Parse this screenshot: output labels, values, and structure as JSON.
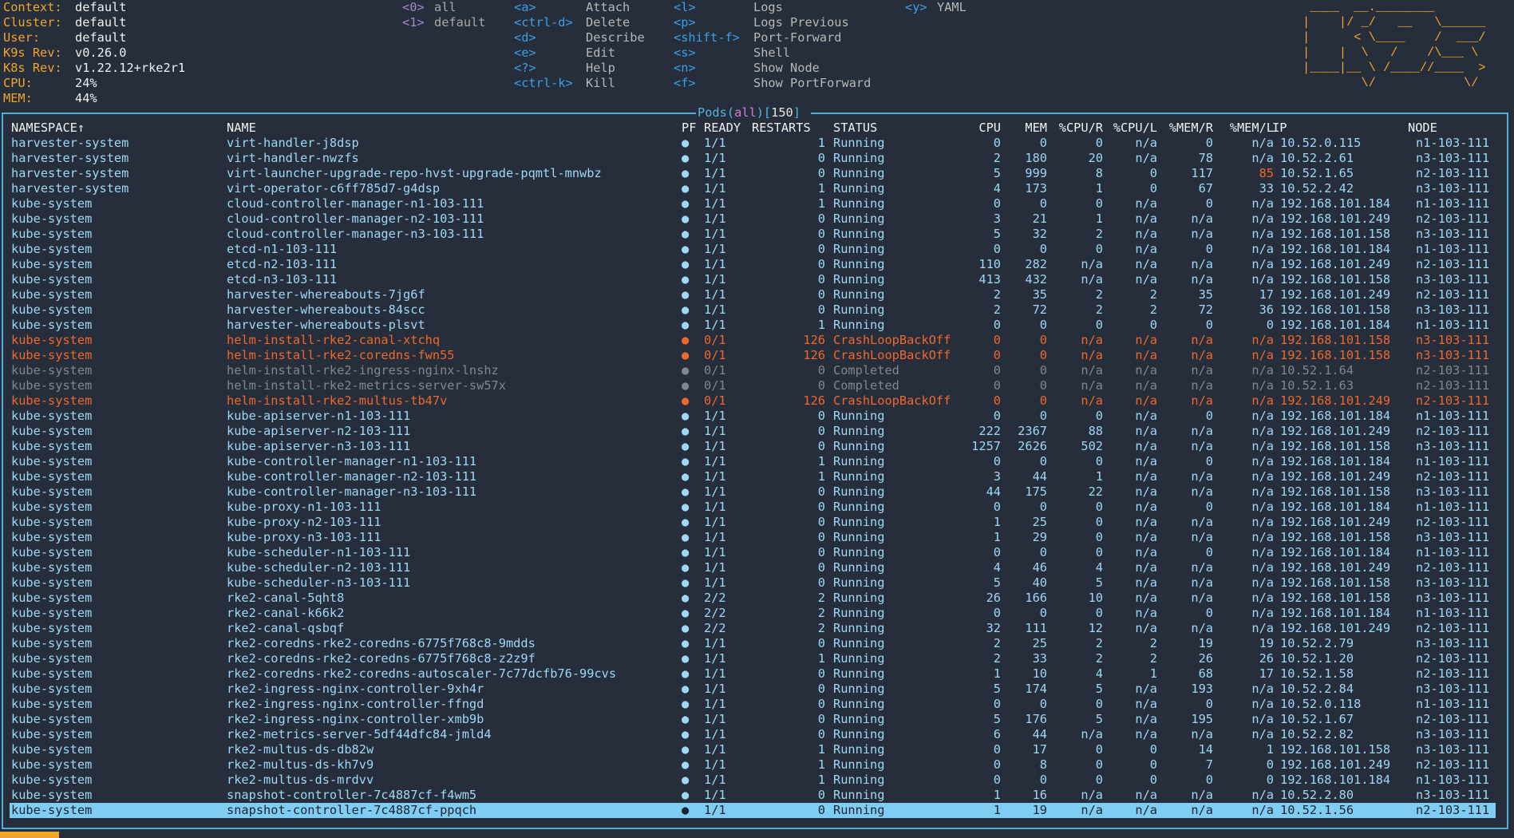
{
  "header": {
    "info": [
      {
        "key": "Context:",
        "value": "default"
      },
      {
        "key": "Cluster:",
        "value": "default"
      },
      {
        "key": "User:",
        "value": "default"
      },
      {
        "key": "K9s Rev:",
        "value": "v0.26.0"
      },
      {
        "key": "K8s Rev:",
        "value": "v1.22.12+rke2r1"
      },
      {
        "key": "CPU:",
        "value": "24%"
      },
      {
        "key": "MEM:",
        "value": "44%"
      }
    ],
    "namespaces": [
      {
        "key": "<0>",
        "label": "all"
      },
      {
        "key": "<1>",
        "label": "default"
      }
    ],
    "shortcuts_col1": [
      {
        "key": "<a>",
        "label": "Attach"
      },
      {
        "key": "<ctrl-d>",
        "label": "Delete"
      },
      {
        "key": "<d>",
        "label": "Describe"
      },
      {
        "key": "<e>",
        "label": "Edit"
      },
      {
        "key": "<?>",
        "label": "Help"
      },
      {
        "key": "<ctrl-k>",
        "label": "Kill"
      }
    ],
    "shortcuts_col2": [
      {
        "key": "<l>",
        "label": "Logs"
      },
      {
        "key": "<p>",
        "label": "Logs Previous"
      },
      {
        "key": "<shift-f>",
        "label": "Port-Forward"
      },
      {
        "key": "<s>",
        "label": "Shell"
      },
      {
        "key": "<n>",
        "label": "Show Node"
      },
      {
        "key": "<f>",
        "label": "Show PortForward"
      }
    ],
    "shortcuts_col3": [
      {
        "key": "<y>",
        "label": "YAML"
      }
    ],
    "logo": " ____  __.________       \n|    |/ _/   __   \\______\n|      < \\____    /  ___/\n|    |  \\   /    /\\___ \\ \n|____|__ \\ /____//____  >\n        \\/            \\/ "
  },
  "table": {
    "title_name": "Pods",
    "title_ns": "all",
    "title_count": "150",
    "columns": {
      "namespace": "NAMESPACE↑",
      "name": "NAME",
      "pf": "PF",
      "ready": "READY",
      "restarts": "RESTARTS",
      "status": "STATUS",
      "cpu": "CPU",
      "mem": "MEM",
      "cpur": "%CPU/R",
      "cpul": "%CPU/L",
      "memr": "%MEM/R",
      "meml": "%MEM/L",
      "ip": "IP",
      "node": "NODE"
    },
    "rows": [
      [
        "harvester-system",
        "virt-handler-j8dsp",
        "●",
        "1/1",
        "1",
        "Running",
        "0",
        "0",
        "0",
        "n/a",
        "0",
        "n/a",
        "10.52.0.115",
        "n1-103-111",
        "ok"
      ],
      [
        "harvester-system",
        "virt-handler-nwzfs",
        "●",
        "1/1",
        "0",
        "Running",
        "2",
        "180",
        "20",
        "n/a",
        "78",
        "n/a",
        "10.52.2.61",
        "n3-103-111",
        "ok"
      ],
      [
        "harvester-system",
        "virt-launcher-upgrade-repo-hvst-upgrade-pqmtl-mnwbz",
        "●",
        "1/1",
        "0",
        "Running",
        "5",
        "999",
        "8",
        "0",
        "117",
        "85",
        "10.52.1.65",
        "n2-103-111",
        "warnml"
      ],
      [
        "harvester-system",
        "virt-operator-c6ff785d7-g4dsp",
        "●",
        "1/1",
        "1",
        "Running",
        "4",
        "173",
        "1",
        "0",
        "67",
        "33",
        "10.52.2.42",
        "n3-103-111",
        "ok"
      ],
      [
        "kube-system",
        "cloud-controller-manager-n1-103-111",
        "●",
        "1/1",
        "1",
        "Running",
        "0",
        "0",
        "0",
        "n/a",
        "0",
        "n/a",
        "192.168.101.184",
        "n1-103-111",
        "ok"
      ],
      [
        "kube-system",
        "cloud-controller-manager-n2-103-111",
        "●",
        "1/1",
        "0",
        "Running",
        "3",
        "21",
        "1",
        "n/a",
        "n/a",
        "n/a",
        "192.168.101.249",
        "n2-103-111",
        "ok"
      ],
      [
        "kube-system",
        "cloud-controller-manager-n3-103-111",
        "●",
        "1/1",
        "0",
        "Running",
        "5",
        "32",
        "2",
        "n/a",
        "n/a",
        "n/a",
        "192.168.101.158",
        "n3-103-111",
        "ok"
      ],
      [
        "kube-system",
        "etcd-n1-103-111",
        "●",
        "1/1",
        "0",
        "Running",
        "0",
        "0",
        "0",
        "n/a",
        "0",
        "n/a",
        "192.168.101.184",
        "n1-103-111",
        "ok"
      ],
      [
        "kube-system",
        "etcd-n2-103-111",
        "●",
        "1/1",
        "0",
        "Running",
        "110",
        "282",
        "n/a",
        "n/a",
        "n/a",
        "n/a",
        "192.168.101.249",
        "n2-103-111",
        "ok"
      ],
      [
        "kube-system",
        "etcd-n3-103-111",
        "●",
        "1/1",
        "0",
        "Running",
        "413",
        "432",
        "n/a",
        "n/a",
        "n/a",
        "n/a",
        "192.168.101.158",
        "n3-103-111",
        "ok"
      ],
      [
        "kube-system",
        "harvester-whereabouts-7jg6f",
        "●",
        "1/1",
        "0",
        "Running",
        "2",
        "35",
        "2",
        "2",
        "35",
        "17",
        "192.168.101.249",
        "n2-103-111",
        "ok"
      ],
      [
        "kube-system",
        "harvester-whereabouts-84scc",
        "●",
        "1/1",
        "0",
        "Running",
        "2",
        "72",
        "2",
        "2",
        "72",
        "36",
        "192.168.101.158",
        "n3-103-111",
        "ok"
      ],
      [
        "kube-system",
        "harvester-whereabouts-plsvt",
        "●",
        "1/1",
        "1",
        "Running",
        "0",
        "0",
        "0",
        "0",
        "0",
        "0",
        "192.168.101.184",
        "n1-103-111",
        "ok"
      ],
      [
        "kube-system",
        "helm-install-rke2-canal-xtchq",
        "●",
        "0/1",
        "126",
        "CrashLoopBackOff",
        "0",
        "0",
        "n/a",
        "n/a",
        "n/a",
        "n/a",
        "192.168.101.158",
        "n3-103-111",
        "err"
      ],
      [
        "kube-system",
        "helm-install-rke2-coredns-fwn55",
        "●",
        "0/1",
        "126",
        "CrashLoopBackOff",
        "0",
        "0",
        "n/a",
        "n/a",
        "n/a",
        "n/a",
        "192.168.101.158",
        "n3-103-111",
        "err"
      ],
      [
        "kube-system",
        "helm-install-rke2-ingress-nginx-lnshz",
        "●",
        "0/1",
        "0",
        "Completed",
        "0",
        "0",
        "n/a",
        "n/a",
        "n/a",
        "n/a",
        "10.52.1.64",
        "n2-103-111",
        "done"
      ],
      [
        "kube-system",
        "helm-install-rke2-metrics-server-sw57x",
        "●",
        "0/1",
        "0",
        "Completed",
        "0",
        "0",
        "n/a",
        "n/a",
        "n/a",
        "n/a",
        "10.52.1.63",
        "n2-103-111",
        "done"
      ],
      [
        "kube-system",
        "helm-install-rke2-multus-tb47v",
        "●",
        "0/1",
        "126",
        "CrashLoopBackOff",
        "0",
        "0",
        "n/a",
        "n/a",
        "n/a",
        "n/a",
        "192.168.101.249",
        "n2-103-111",
        "err"
      ],
      [
        "kube-system",
        "kube-apiserver-n1-103-111",
        "●",
        "1/1",
        "0",
        "Running",
        "0",
        "0",
        "0",
        "n/a",
        "0",
        "n/a",
        "192.168.101.184",
        "n1-103-111",
        "ok"
      ],
      [
        "kube-system",
        "kube-apiserver-n2-103-111",
        "●",
        "1/1",
        "0",
        "Running",
        "222",
        "2367",
        "88",
        "n/a",
        "n/a",
        "n/a",
        "192.168.101.249",
        "n2-103-111",
        "ok"
      ],
      [
        "kube-system",
        "kube-apiserver-n3-103-111",
        "●",
        "1/1",
        "0",
        "Running",
        "1257",
        "2626",
        "502",
        "n/a",
        "n/a",
        "n/a",
        "192.168.101.158",
        "n3-103-111",
        "ok"
      ],
      [
        "kube-system",
        "kube-controller-manager-n1-103-111",
        "●",
        "1/1",
        "1",
        "Running",
        "0",
        "0",
        "0",
        "n/a",
        "0",
        "n/a",
        "192.168.101.184",
        "n1-103-111",
        "ok"
      ],
      [
        "kube-system",
        "kube-controller-manager-n2-103-111",
        "●",
        "1/1",
        "1",
        "Running",
        "3",
        "44",
        "1",
        "n/a",
        "n/a",
        "n/a",
        "192.168.101.249",
        "n2-103-111",
        "ok"
      ],
      [
        "kube-system",
        "kube-controller-manager-n3-103-111",
        "●",
        "1/1",
        "0",
        "Running",
        "44",
        "175",
        "22",
        "n/a",
        "n/a",
        "n/a",
        "192.168.101.158",
        "n3-103-111",
        "ok"
      ],
      [
        "kube-system",
        "kube-proxy-n1-103-111",
        "●",
        "1/1",
        "0",
        "Running",
        "0",
        "0",
        "0",
        "n/a",
        "0",
        "n/a",
        "192.168.101.184",
        "n1-103-111",
        "ok"
      ],
      [
        "kube-system",
        "kube-proxy-n2-103-111",
        "●",
        "1/1",
        "0",
        "Running",
        "1",
        "25",
        "0",
        "n/a",
        "n/a",
        "n/a",
        "192.168.101.249",
        "n2-103-111",
        "ok"
      ],
      [
        "kube-system",
        "kube-proxy-n3-103-111",
        "●",
        "1/1",
        "0",
        "Running",
        "1",
        "29",
        "0",
        "n/a",
        "n/a",
        "n/a",
        "192.168.101.158",
        "n3-103-111",
        "ok"
      ],
      [
        "kube-system",
        "kube-scheduler-n1-103-111",
        "●",
        "1/1",
        "0",
        "Running",
        "0",
        "0",
        "0",
        "n/a",
        "0",
        "n/a",
        "192.168.101.184",
        "n1-103-111",
        "ok"
      ],
      [
        "kube-system",
        "kube-scheduler-n2-103-111",
        "●",
        "1/1",
        "0",
        "Running",
        "4",
        "46",
        "4",
        "n/a",
        "n/a",
        "n/a",
        "192.168.101.249",
        "n2-103-111",
        "ok"
      ],
      [
        "kube-system",
        "kube-scheduler-n3-103-111",
        "●",
        "1/1",
        "0",
        "Running",
        "5",
        "40",
        "5",
        "n/a",
        "n/a",
        "n/a",
        "192.168.101.158",
        "n3-103-111",
        "ok"
      ],
      [
        "kube-system",
        "rke2-canal-5qht8",
        "●",
        "2/2",
        "2",
        "Running",
        "26",
        "166",
        "10",
        "n/a",
        "n/a",
        "n/a",
        "192.168.101.158",
        "n3-103-111",
        "ok"
      ],
      [
        "kube-system",
        "rke2-canal-k66k2",
        "●",
        "2/2",
        "2",
        "Running",
        "0",
        "0",
        "0",
        "n/a",
        "0",
        "n/a",
        "192.168.101.184",
        "n1-103-111",
        "ok"
      ],
      [
        "kube-system",
        "rke2-canal-qsbqf",
        "●",
        "2/2",
        "2",
        "Running",
        "32",
        "111",
        "12",
        "n/a",
        "n/a",
        "n/a",
        "192.168.101.249",
        "n2-103-111",
        "ok"
      ],
      [
        "kube-system",
        "rke2-coredns-rke2-coredns-6775f768c8-9mdds",
        "●",
        "1/1",
        "0",
        "Running",
        "2",
        "25",
        "2",
        "2",
        "19",
        "19",
        "10.52.2.79",
        "n3-103-111",
        "ok"
      ],
      [
        "kube-system",
        "rke2-coredns-rke2-coredns-6775f768c8-z2z9f",
        "●",
        "1/1",
        "1",
        "Running",
        "2",
        "33",
        "2",
        "2",
        "26",
        "26",
        "10.52.1.20",
        "n2-103-111",
        "ok"
      ],
      [
        "kube-system",
        "rke2-coredns-rke2-coredns-autoscaler-7c77dcfb76-99cvs",
        "●",
        "1/1",
        "0",
        "Running",
        "1",
        "10",
        "4",
        "1",
        "68",
        "17",
        "10.52.1.58",
        "n2-103-111",
        "ok"
      ],
      [
        "kube-system",
        "rke2-ingress-nginx-controller-9xh4r",
        "●",
        "1/1",
        "0",
        "Running",
        "5",
        "174",
        "5",
        "n/a",
        "193",
        "n/a",
        "10.52.2.84",
        "n3-103-111",
        "ok"
      ],
      [
        "kube-system",
        "rke2-ingress-nginx-controller-ffngd",
        "●",
        "1/1",
        "0",
        "Running",
        "0",
        "0",
        "0",
        "n/a",
        "0",
        "n/a",
        "10.52.0.118",
        "n1-103-111",
        "ok"
      ],
      [
        "kube-system",
        "rke2-ingress-nginx-controller-xmb9b",
        "●",
        "1/1",
        "0",
        "Running",
        "5",
        "176",
        "5",
        "n/a",
        "195",
        "n/a",
        "10.52.1.67",
        "n2-103-111",
        "ok"
      ],
      [
        "kube-system",
        "rke2-metrics-server-5df44dfc84-jmld4",
        "●",
        "1/1",
        "0",
        "Running",
        "6",
        "44",
        "n/a",
        "n/a",
        "n/a",
        "n/a",
        "10.52.2.82",
        "n3-103-111",
        "ok"
      ],
      [
        "kube-system",
        "rke2-multus-ds-db82w",
        "●",
        "1/1",
        "1",
        "Running",
        "0",
        "17",
        "0",
        "0",
        "14",
        "1",
        "192.168.101.158",
        "n3-103-111",
        "ok"
      ],
      [
        "kube-system",
        "rke2-multus-ds-kh7v9",
        "●",
        "1/1",
        "1",
        "Running",
        "0",
        "8",
        "0",
        "0",
        "7",
        "0",
        "192.168.101.249",
        "n2-103-111",
        "ok"
      ],
      [
        "kube-system",
        "rke2-multus-ds-mrdvv",
        "●",
        "1/1",
        "1",
        "Running",
        "0",
        "0",
        "0",
        "0",
        "0",
        "0",
        "192.168.101.184",
        "n1-103-111",
        "ok"
      ],
      [
        "kube-system",
        "snapshot-controller-7c4887cf-f4wm5",
        "●",
        "1/1",
        "0",
        "Running",
        "1",
        "16",
        "n/a",
        "n/a",
        "n/a",
        "n/a",
        "10.52.2.80",
        "n3-103-111",
        "ok"
      ],
      [
        "kube-system",
        "snapshot-controller-7c4887cf-ppqch",
        "●",
        "1/1",
        "0",
        "Running",
        "1",
        "19",
        "n/a",
        "n/a",
        "n/a",
        "n/a",
        "10.52.1.56",
        "n2-103-111",
        "sel"
      ]
    ]
  },
  "colors": {
    "background": "#262d3b",
    "header_key": "#f2a627",
    "row_text": "#9fd8f5",
    "error_text": "#f0682b",
    "completed_text": "#808692",
    "selected_bg": "#80cdf3",
    "frame": "#4fb0d8"
  }
}
